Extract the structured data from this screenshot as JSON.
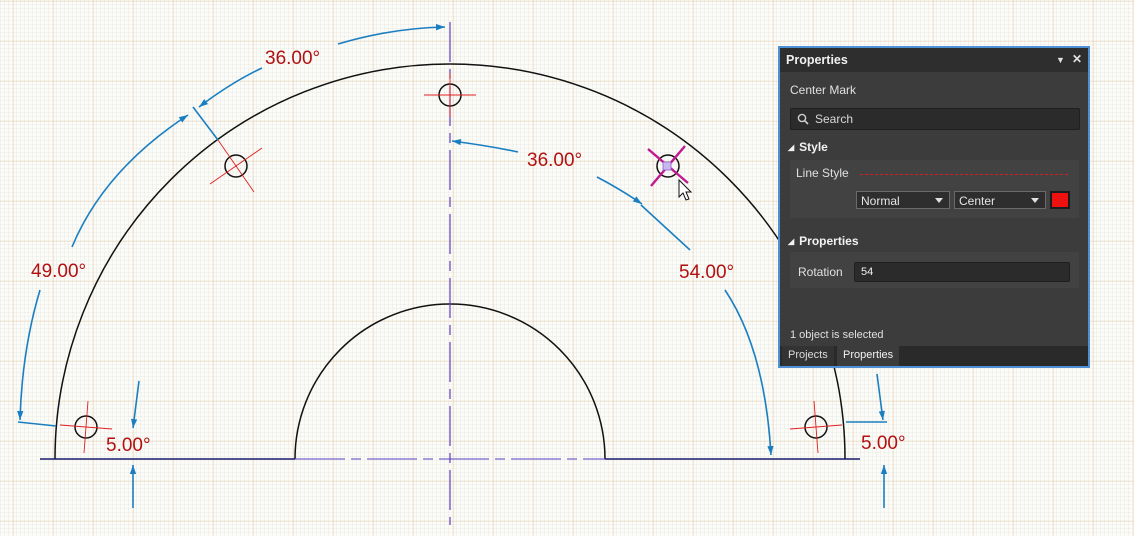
{
  "drawing": {
    "dimensions": [
      "36.00°",
      "36.00°",
      "49.00°",
      "54.00°",
      "5.00°",
      "5.00°"
    ],
    "colors": {
      "geometry": "#111111",
      "dimension_line": "#1a7fc1",
      "dimension_text": "#b31010",
      "center_mark": "#e02020",
      "axis": "#5a3fc0",
      "grid_major": "#f0c49a",
      "grid_minor": "#d6d6d2"
    }
  },
  "panel": {
    "title": "Properties",
    "object_type": "Center Mark",
    "search": {
      "placeholder": "Search",
      "icon": "search-icon"
    },
    "style": {
      "section_label": "Style",
      "line_style_label": "Line Style",
      "line_style_value": "Normal",
      "line_type_value": "Center",
      "color": "#ee1111"
    },
    "properties": {
      "section_label": "Properties",
      "rotation_label": "Rotation",
      "rotation_value": "54"
    },
    "status": "1 object is selected",
    "tabs": [
      "Projects",
      "Properties"
    ]
  }
}
